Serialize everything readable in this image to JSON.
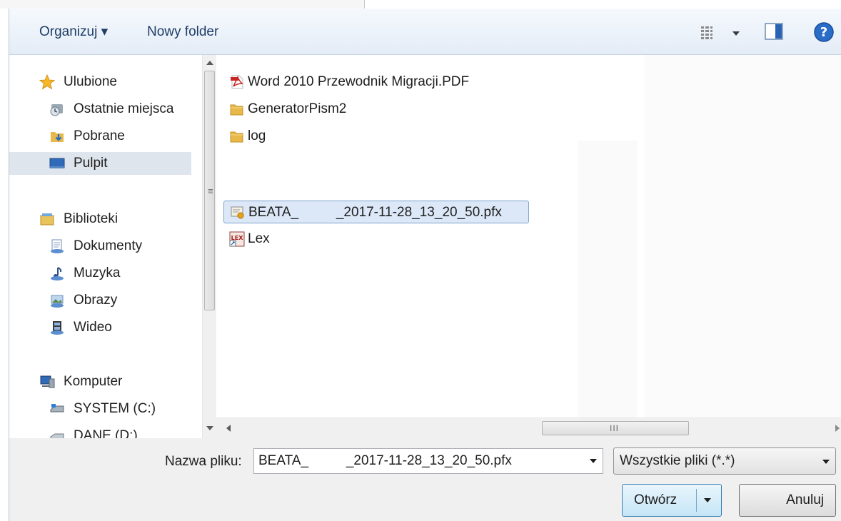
{
  "toolbar": {
    "organize_label": "Organizuj ▾",
    "new_folder_label": "Nowy folder"
  },
  "nav": {
    "favorites": {
      "label": "Ulubione",
      "items": [
        {
          "label": "Ostatnie miejsca"
        },
        {
          "label": "Pobrane"
        },
        {
          "label": "Pulpit"
        }
      ]
    },
    "libraries": {
      "label": "Biblioteki",
      "items": [
        {
          "label": "Dokumenty"
        },
        {
          "label": "Muzyka"
        },
        {
          "label": "Obrazy"
        },
        {
          "label": "Wideo"
        }
      ]
    },
    "computer": {
      "label": "Komputer",
      "items": [
        {
          "label": "SYSTEM (C:)"
        },
        {
          "label": "DANE (D:)"
        }
      ]
    }
  },
  "files": [
    {
      "name": "Word 2010 Przewodnik Migracji.PDF",
      "icon": "pdf-icon"
    },
    {
      "name": "GeneratorPism2",
      "icon": "folder-icon"
    },
    {
      "name": "log",
      "icon": "folder-icon"
    },
    {
      "name": "BEATA_          _2017-11-28_13_20_50.pfx",
      "icon": "certificate-icon"
    },
    {
      "name": "Lex",
      "icon": "lex-shortcut-icon"
    }
  ],
  "bottom": {
    "filename_label": "Nazwa pliku:",
    "filename_value": "BEATA_          _2017-11-28_13_20_50.pfx",
    "filetype_value": "Wszystkie pliki (*.*)",
    "open_label": "Otwórz",
    "cancel_label": "Anuluj"
  },
  "colors": {
    "toolbar_text": "#1e3d67",
    "selection": "#dce8f7",
    "selection_border": "#7da2ce"
  }
}
